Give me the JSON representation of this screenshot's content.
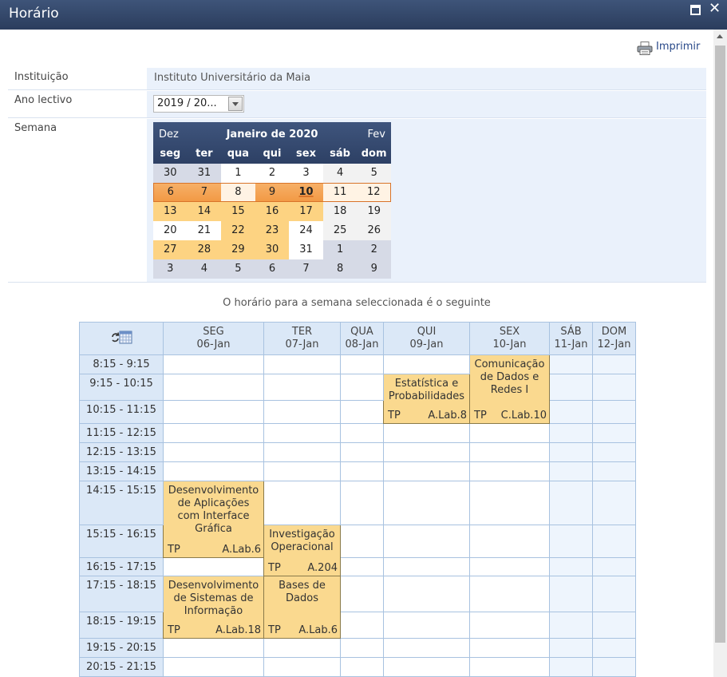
{
  "window": {
    "title": "Horário"
  },
  "toolbar": {
    "print_label": "Imprimir"
  },
  "form": {
    "institution_label": "Instituição",
    "institution_value": "Instituto Universitário da Maia",
    "year_label": "Ano lectivo",
    "year_value": "2019 / 20...",
    "week_label": "Semana"
  },
  "calendar": {
    "prev": "Dez",
    "month": "Janeiro de 2020",
    "next": "Fev",
    "dows": [
      "seg",
      "ter",
      "qua",
      "qui",
      "sex",
      "sáb",
      "dom"
    ],
    "weeks": [
      [
        "30",
        "31",
        "1",
        "2",
        "3",
        "4",
        "5"
      ],
      [
        "6",
        "7",
        "8",
        "9",
        "10",
        "11",
        "12"
      ],
      [
        "13",
        "14",
        "15",
        "16",
        "17",
        "18",
        "19"
      ],
      [
        "20",
        "21",
        "22",
        "23",
        "24",
        "25",
        "26"
      ],
      [
        "27",
        "28",
        "29",
        "30",
        "31",
        "1",
        "2"
      ],
      [
        "3",
        "4",
        "5",
        "6",
        "7",
        "8",
        "9"
      ]
    ],
    "selected_day": "10"
  },
  "caption": "O horário para a semana seleccionada é o seguinte",
  "schedule": {
    "days": [
      {
        "name": "SEG",
        "date": "06-Jan"
      },
      {
        "name": "TER",
        "date": "07-Jan"
      },
      {
        "name": "QUA",
        "date": "08-Jan"
      },
      {
        "name": "QUI",
        "date": "09-Jan"
      },
      {
        "name": "SEX",
        "date": "10-Jan"
      },
      {
        "name": "SÁB",
        "date": "11-Jan"
      },
      {
        "name": "DOM",
        "date": "12-Jan"
      }
    ],
    "times": [
      "8:15 - 9:15",
      "9:15 - 10:15",
      "10:15 - 11:15",
      "11:15 - 12:15",
      "12:15 - 13:15",
      "13:15 - 14:15",
      "14:15 - 15:15",
      "15:15 - 16:15",
      "16:15 - 17:15",
      "17:15 - 18:15",
      "18:15 - 19:15",
      "19:15 - 20:15",
      "20:15 - 21:15"
    ],
    "events": [
      {
        "title": "Estatística e Probabilidades",
        "type": "TP",
        "room": "A.Lab.8"
      },
      {
        "title": "Comunicação de Dados e Redes I",
        "type": "TP",
        "room": "C.Lab.10"
      },
      {
        "title": "Desenvolvimento de Aplicações com Interface Gráfica",
        "type": "TP",
        "room": "A.Lab.6"
      },
      {
        "title": "Investigação Operacional",
        "type": "TP",
        "room": "A.204"
      },
      {
        "title": "Desenvolvimento de Sistemas de Informação",
        "type": "TP",
        "room": "A.Lab.18"
      },
      {
        "title": "Bases de Dados",
        "type": "TP",
        "room": "A.Lab.6"
      }
    ]
  }
}
